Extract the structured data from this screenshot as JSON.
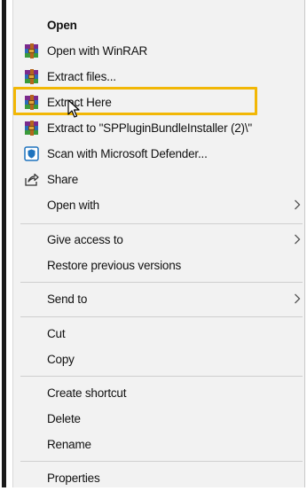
{
  "menu": {
    "items": [
      {
        "label": "Open",
        "icon": "",
        "bold": true,
        "arrow": false
      },
      {
        "label": "Open with WinRAR",
        "icon": "winrar-icon",
        "bold": false,
        "arrow": false
      },
      {
        "label": "Extract files...",
        "icon": "winrar-icon",
        "bold": false,
        "arrow": false
      },
      {
        "label": "Extract Here",
        "icon": "winrar-icon",
        "bold": false,
        "arrow": false
      },
      {
        "label": "Extract to \"SPPluginBundleInstaller (2)\\\"",
        "icon": "winrar-icon",
        "bold": false,
        "arrow": false
      },
      {
        "label": "Scan with Microsoft Defender...",
        "icon": "defender-icon",
        "bold": false,
        "arrow": false
      },
      {
        "label": "Share",
        "icon": "share-icon",
        "bold": false,
        "arrow": false
      },
      {
        "label": "Open with",
        "icon": "",
        "bold": false,
        "arrow": true
      },
      {
        "label": "Give access to",
        "icon": "",
        "bold": false,
        "arrow": true
      },
      {
        "label": "Restore previous versions",
        "icon": "",
        "bold": false,
        "arrow": false
      },
      {
        "label": "Send to",
        "icon": "",
        "bold": false,
        "arrow": true
      },
      {
        "label": "Cut",
        "icon": "",
        "bold": false,
        "arrow": false
      },
      {
        "label": "Copy",
        "icon": "",
        "bold": false,
        "arrow": false
      },
      {
        "label": "Create shortcut",
        "icon": "",
        "bold": false,
        "arrow": false
      },
      {
        "label": "Delete",
        "icon": "",
        "bold": false,
        "arrow": false
      },
      {
        "label": "Rename",
        "icon": "",
        "bold": false,
        "arrow": false
      },
      {
        "label": "Properties",
        "icon": "",
        "bold": false,
        "arrow": false
      }
    ],
    "highlighted_item": "Extract Here"
  },
  "colors": {
    "menu_background": "#f2f2f2",
    "highlight_border": "#f2b705",
    "separator": "#cfcfcf",
    "text": "#111111"
  }
}
